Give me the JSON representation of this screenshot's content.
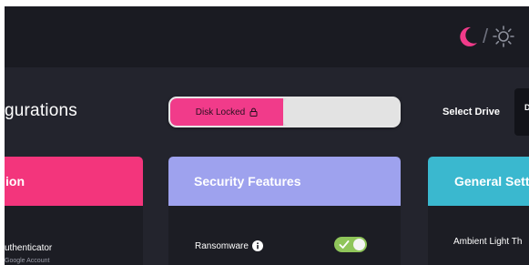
{
  "header": {
    "theme_dark_icon": "moon-icon",
    "theme_separator": "/",
    "theme_light_icon": "sun-icon",
    "accent": "#f13b8a"
  },
  "main": {
    "title": "gurations",
    "disk_lock": {
      "locked_label": "Disk Locked",
      "icon": "lock-icon",
      "locked_color": "#f13b8a",
      "unlocked_color": "#e3e3e3"
    },
    "select_drive": {
      "label": "Select Drive",
      "value": "D"
    }
  },
  "cards": [
    {
      "title": "ion",
      "color": "#f3357c",
      "items": [
        {
          "label": "uthenticator",
          "sublabel": "Google Account"
        }
      ]
    },
    {
      "title": "Security Features",
      "color": "#9ea2ee",
      "items": [
        {
          "label": "Ransomware",
          "info_icon": "info-icon",
          "enabled": true
        }
      ]
    },
    {
      "title": "General Sett",
      "color": "#3ab8cf",
      "items": [
        {
          "label": "Ambient Light Th"
        }
      ]
    }
  ]
}
